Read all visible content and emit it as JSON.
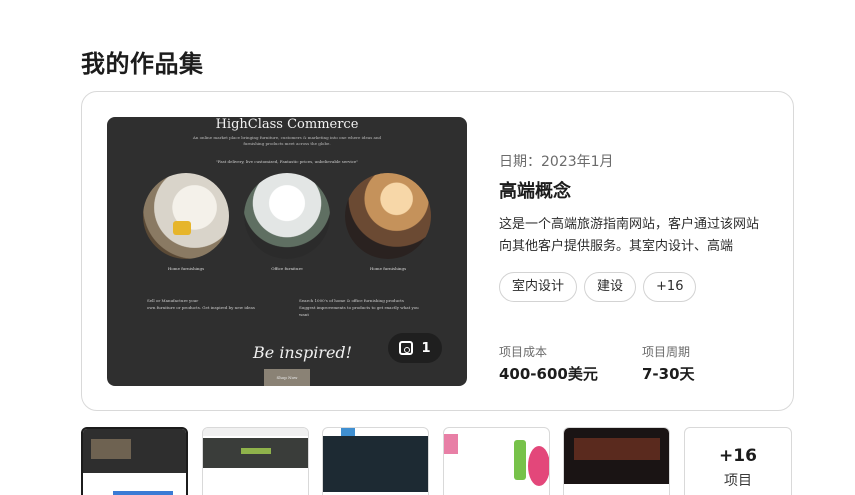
{
  "page": {
    "title": "我的作品集"
  },
  "project": {
    "preview": {
      "site_title": "HighClass Commerce",
      "site_sub": "An online market place bringing furniture, customers & marketing into one where ideas and furnishing products meet across the globe.",
      "quote": "\"Fast delivery, live customized, Fantastic prices, unbelievable service\"",
      "captions": [
        "Home furnishings",
        "Office furniture",
        "Home furnishings"
      ],
      "bullets_left": [
        "Sell or Manufacture your",
        "own furniture or products. Get inspired by new ideas"
      ],
      "bullets_right": [
        "Search 1000's of home & office furnishing products",
        "Suggest improvements to products to get exactly what you want"
      ],
      "headline": "Be inspired!",
      "shop_button": "Shop Now",
      "image_count": "1"
    },
    "date": "日期：2023年1月",
    "name": "高端概念",
    "description": "这是一个高端旅游指南网站，客户通过该网站向其他客户提供服务。其室内设计、高端",
    "tags": [
      "室内设计",
      "建设",
      "+16"
    ],
    "cost_label": "项目成本",
    "cost_value": "400-600美元",
    "duration_label": "项目周期",
    "duration_value": "7-30天"
  },
  "gallery": {
    "more_count": "+16",
    "more_label": "项目"
  },
  "icons": {
    "image_count": "images-icon"
  },
  "colors": {
    "preview_bg": "#2f2f2f",
    "badge_bg": "#1f1f1f",
    "border": "#d9d9d9"
  }
}
